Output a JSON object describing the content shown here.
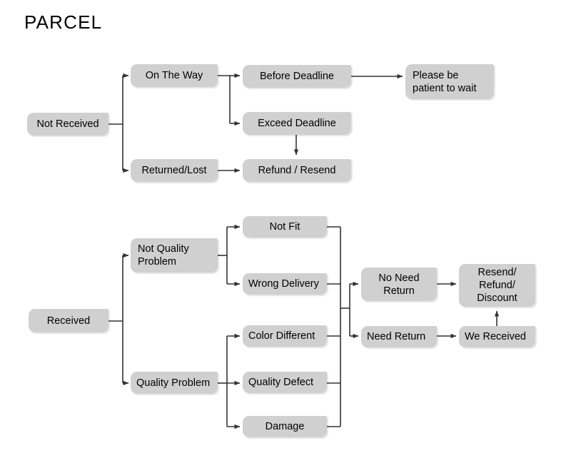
{
  "title": "PARCEL",
  "colors": {
    "node_fill": "#d0d0d0",
    "node_text": "#000000",
    "connector": "#333333",
    "background": "#ffffff"
  },
  "nodes": {
    "not_received": "Not Received",
    "on_the_way": "On The Way",
    "returned_lost": "Returned/Lost",
    "before_deadline": "Before Deadline",
    "exceed_deadline": "Exceed Deadline",
    "refund_resend": "Refund / Resend",
    "please_be_patient": "Please be\npatient to wait",
    "received": "Received",
    "not_quality_problem": "Not Quality\nProblem",
    "quality_problem": "Quality Problem",
    "not_fit": "Not Fit",
    "wrong_delivery": "Wrong Delivery",
    "color_different": "Color Different",
    "quality_defect": "Quality Defect",
    "damage": "Damage",
    "no_need_return": "No Need\nReturn",
    "need_return": "Need Return",
    "resend_refund_discount": "Resend/\nRefund/\nDiscount",
    "we_received": "We Received"
  },
  "diagram": {
    "type": "flowchart",
    "orientation": "left-to-right",
    "branches": [
      {
        "root": "Not Received",
        "children": [
          {
            "label": "On The Way",
            "children": [
              {
                "label": "Before Deadline",
                "children": [
                  {
                    "label": "Please be patient to wait",
                    "children": []
                  }
                ]
              },
              {
                "label": "Exceed Deadline",
                "children": [
                  {
                    "label": "Refund / Resend",
                    "children": []
                  }
                ]
              }
            ]
          },
          {
            "label": "Returned/Lost",
            "children": [
              {
                "label": "Refund / Resend",
                "children": []
              }
            ]
          }
        ]
      },
      {
        "root": "Received",
        "children": [
          {
            "label": "Not Quality Problem",
            "children": [
              {
                "label": "Not Fit",
                "children": []
              },
              {
                "label": "Wrong Delivery",
                "children": []
              }
            ]
          },
          {
            "label": "Quality Problem",
            "children": [
              {
                "label": "Color Different",
                "children": []
              },
              {
                "label": "Quality Defect",
                "children": []
              },
              {
                "label": "Damage",
                "children": []
              }
            ]
          }
        ],
        "merge": {
          "from": [
            "Not Fit",
            "Wrong Delivery",
            "Color Different",
            "Quality Defect",
            "Damage"
          ],
          "to": [
            "No Need Return",
            "Need Return"
          ],
          "outcomes": [
            {
              "from": "No Need Return",
              "to": "Resend/Refund/Discount"
            },
            {
              "from": "Need Return",
              "to": "We Received"
            },
            {
              "from": "We Received",
              "to": "Resend/Refund/Discount"
            }
          ]
        }
      }
    ]
  }
}
